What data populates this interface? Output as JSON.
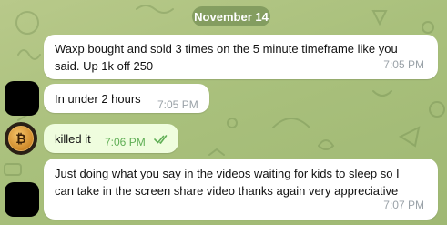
{
  "chat": {
    "date_label": "November 14",
    "messages": [
      {
        "text_line1": "Waxp bought and sold 3 times on the 5 minute timeframe like you",
        "text_line2": "said. Up 1k off 250",
        "time": "7:05 PM"
      },
      {
        "text": "In under 2 hours",
        "time": "7:05 PM"
      },
      {
        "text": "killed it",
        "time": "7:06 PM",
        "status": "read-double-check-icon"
      },
      {
        "text_line1": "Just doing what you say in the videos waiting for kids to sleep so I",
        "text_line2": "can take in the screen share video thanks again very appreciative",
        "time": "7:07 PM"
      }
    ],
    "avatar_coin_glyph": "₿"
  }
}
